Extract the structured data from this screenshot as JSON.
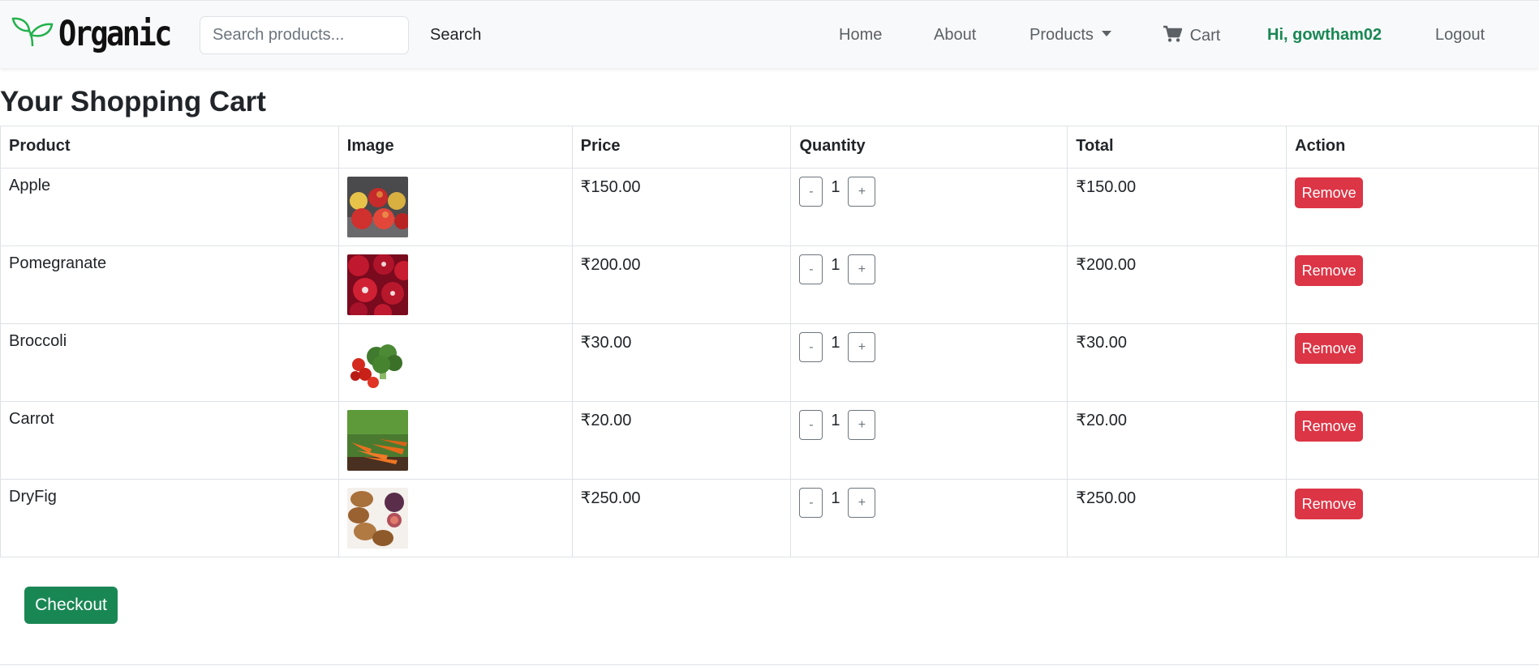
{
  "brand": {
    "name": "Organic",
    "logo_icon": "leaf-sprout-icon",
    "logo_color": "#22b14c"
  },
  "search": {
    "placeholder": "Search products...",
    "value": "",
    "button_label": "Search"
  },
  "nav": {
    "home": "Home",
    "about": "About",
    "products": "Products",
    "cart": "Cart",
    "greeting": "Hi, gowtham02",
    "logout": "Logout"
  },
  "page": {
    "title": "Your Shopping Cart"
  },
  "table": {
    "headers": [
      "Product",
      "Image",
      "Price",
      "Quantity",
      "Total",
      "Action"
    ],
    "rows": [
      {
        "product": "Apple",
        "image_icon": "apple-image",
        "price": "₹150.00",
        "quantity": "1",
        "total": "₹150.00",
        "action": "Remove",
        "minus": "-",
        "plus": "+"
      },
      {
        "product": "Pomegranate",
        "image_icon": "pomegranate-image",
        "price": "₹200.00",
        "quantity": "1",
        "total": "₹200.00",
        "action": "Remove",
        "minus": "-",
        "plus": "+"
      },
      {
        "product": "Broccoli",
        "image_icon": "broccoli-image",
        "price": "₹30.00",
        "quantity": "1",
        "total": "₹30.00",
        "action": "Remove",
        "minus": "-",
        "plus": "+"
      },
      {
        "product": "Carrot",
        "image_icon": "carrot-image",
        "price": "₹20.00",
        "quantity": "1",
        "total": "₹20.00",
        "action": "Remove",
        "minus": "-",
        "plus": "+"
      },
      {
        "product": "DryFig",
        "image_icon": "dryfig-image",
        "price": "₹250.00",
        "quantity": "1",
        "total": "₹250.00",
        "action": "Remove",
        "minus": "-",
        "plus": "+"
      }
    ]
  },
  "checkout": {
    "label": "Checkout"
  },
  "colors": {
    "success": "#198754",
    "danger": "#dc3545",
    "navbar_bg": "#f8f9fa"
  }
}
